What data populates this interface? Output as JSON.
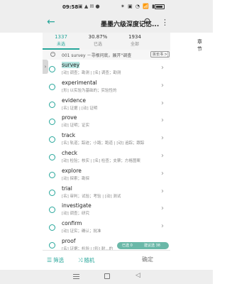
{
  "status": {
    "time": "09:58",
    "left_icons": "▣ ▲ ✉ ●",
    "right_icons": "✶ ▣ ◔ 📶 ▮"
  },
  "header": {
    "title": "墨墨六级深度记忆..."
  },
  "stats": [
    {
      "value": "1337",
      "label": "未选",
      "active": true
    },
    {
      "value": "30.87%",
      "label": "已选",
      "active": false
    },
    {
      "value": "1934",
      "label": "全部",
      "active": false
    }
  ],
  "chapter_label": "章节",
  "section": {
    "text": "001 survey －寻根问底，展开\"调查",
    "button": "拆长书 >"
  },
  "words": [
    {
      "word": "survey",
      "def": "[动] 调查；勘测 | [名] 调查；勘测",
      "highlight": true
    },
    {
      "word": "experimental",
      "def": "[形] 以实验为基础的；实验性的",
      "highlight": false
    },
    {
      "word": "evidence",
      "def": "[名] 证据 | [动] 证明",
      "highlight": false
    },
    {
      "word": "prove",
      "def": "[动] 证明；证实",
      "highlight": false
    },
    {
      "word": "track",
      "def": "[名] 轨道；踪迹；小路；跑道 | [动] 追踪；跟踪",
      "highlight": false
    },
    {
      "word": "check",
      "def": "[动] 检验；核实 | [名] 检查；支票；方格图案",
      "highlight": false
    },
    {
      "word": "explore",
      "def": "[动] 探索；勘探",
      "highlight": false
    },
    {
      "word": "trial",
      "def": "[名] 审判；试验；考验 | [动] 测试",
      "highlight": false
    },
    {
      "word": "investigate",
      "def": "[动] 调查；研究",
      "highlight": false
    },
    {
      "word": "confirm",
      "def": "[动] 证实；确认；批准",
      "highlight": false
    },
    {
      "word": "proof",
      "def": "[名] 证据；检验 | [形] 耐...的",
      "highlight": false
    }
  ],
  "pill": {
    "selected": "已选 0",
    "suggested": "建议选 38"
  },
  "bottom": {
    "filter": "筛选",
    "random": "随机",
    "confirm": "确定"
  },
  "colors": {
    "accent": "#26a69a"
  }
}
